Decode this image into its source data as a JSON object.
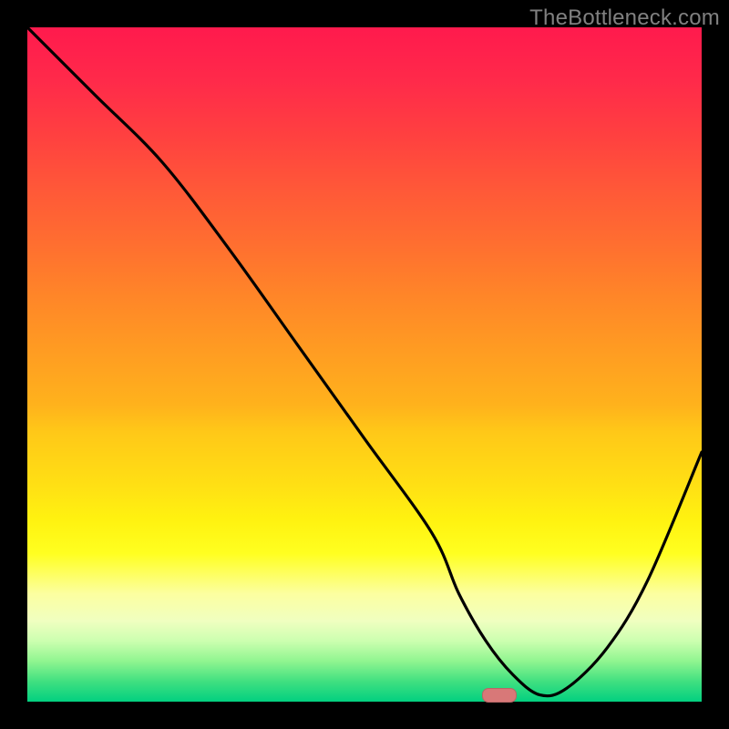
{
  "watermark": "TheBottleneck.com",
  "chart_data": {
    "type": "line",
    "title": "",
    "xlabel": "",
    "ylabel": "",
    "xlim": [
      0,
      100
    ],
    "ylim": [
      0,
      100
    ],
    "x": [
      0,
      10,
      20,
      30,
      40,
      50,
      60,
      64,
      68,
      72,
      76,
      80,
      86,
      92,
      100
    ],
    "values": [
      100,
      90,
      80,
      67,
      53,
      39,
      25,
      16,
      9,
      4,
      1,
      2,
      8,
      18,
      37
    ],
    "marker": {
      "x": 70,
      "y": 1,
      "color": "#d87878"
    },
    "background": {
      "type": "vertical-gradient",
      "stops": [
        {
          "pos": 0,
          "color": "#ff1a4d"
        },
        {
          "pos": 50,
          "color": "#ff9c22"
        },
        {
          "pos": 78,
          "color": "#ffff20"
        },
        {
          "pos": 100,
          "color": "#02d080"
        }
      ]
    }
  }
}
